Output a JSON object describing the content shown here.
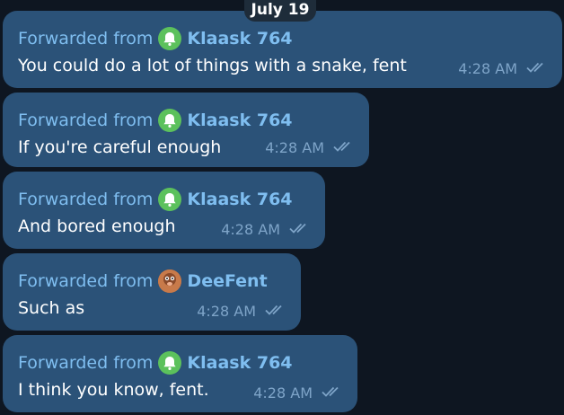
{
  "date_separator": "July 19",
  "messages": [
    {
      "forward_label": "Forwarded from",
      "sender": "Klaask 764",
      "avatar_icon": "green-bell-avatar-icon",
      "text": "You could do a lot of things with a snake, fent",
      "time": "4:28 AM",
      "status_icon": "double-check-icon"
    },
    {
      "forward_label": "Forwarded from",
      "sender": "Klaask 764",
      "avatar_icon": "green-bell-avatar-icon",
      "text": "If you're careful enough",
      "time": "4:28 AM",
      "status_icon": "double-check-icon"
    },
    {
      "forward_label": "Forwarded from",
      "sender": "Klaask 764",
      "avatar_icon": "green-bell-avatar-icon",
      "text": "And bored enough",
      "time": "4:28 AM",
      "status_icon": "double-check-icon"
    },
    {
      "forward_label": "Forwarded from",
      "sender": "DeeFent",
      "avatar_icon": "profile-photo-avatar-icon",
      "text": "Such as",
      "time": "4:28 AM",
      "status_icon": "double-check-icon"
    },
    {
      "forward_label": "Forwarded from",
      "sender": "Klaask 764",
      "avatar_icon": "green-bell-avatar-icon",
      "text": "I think you know, fent.",
      "time": "4:28 AM",
      "status_icon": "double-check-icon"
    }
  ],
  "colors": {
    "background": "#0e1621",
    "bubble": "#2b5278",
    "link": "#7fbef0",
    "meta": "#7ea4c8",
    "avatar_green": "#5cc15c"
  }
}
